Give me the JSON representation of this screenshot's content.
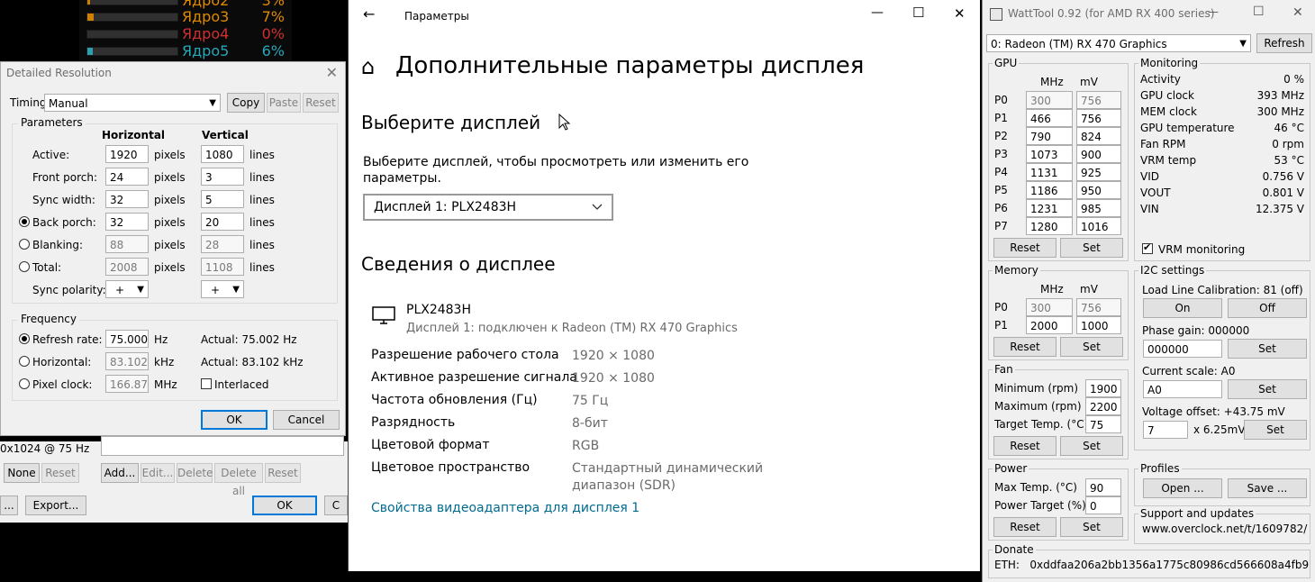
{
  "cpu_cores": [
    {
      "name": "Ядро2",
      "pct": "3%",
      "fill": 0.03,
      "color": "orange"
    },
    {
      "name": "Ядро3",
      "pct": "7%",
      "fill": 0.07,
      "color": "orange"
    },
    {
      "name": "Ядро4",
      "pct": "0%",
      "fill": 0.0,
      "color": "red"
    },
    {
      "name": "Ядро5",
      "pct": "6%",
      "fill": 0.06,
      "color": "teal"
    }
  ],
  "cru_bg": {
    "mode_text": "0x1024 @ 75 Hz",
    "none": "None",
    "reset": "Reset",
    "add": "Add...",
    "edit": "Edit...",
    "delete": "Delete",
    "delete_all": "Delete all",
    "reset2": "Reset",
    "import": "...",
    "export": "Export...",
    "ok": "OK",
    "cancel": "C"
  },
  "detailed": {
    "title": "Detailed Resolution",
    "close": "✕",
    "timing_label": "Timing:",
    "timing_value": "Manual",
    "copy": "Copy",
    "paste": "Paste",
    "reset": "Reset",
    "params_title": "Parameters",
    "col_h": "Horizontal",
    "col_v": "Vertical",
    "rows": [
      {
        "label": "Active:",
        "h": "1920",
        "hu": "pixels",
        "v": "1080",
        "vu": "lines"
      },
      {
        "label": "Front porch:",
        "h": "24",
        "hu": "pixels",
        "v": "3",
        "vu": "lines"
      },
      {
        "label": "Sync width:",
        "h": "32",
        "hu": "pixels",
        "v": "5",
        "vu": "lines"
      },
      {
        "label": "Back porch:",
        "h": "32",
        "hu": "pixels",
        "v": "20",
        "vu": "lines"
      },
      {
        "label": "Blanking:",
        "h": "88",
        "hu": "pixels",
        "v": "28",
        "vu": "lines"
      },
      {
        "label": "Total:",
        "h": "2008",
        "hu": "pixels",
        "v": "1108",
        "vu": "lines"
      }
    ],
    "sync_label": "Sync polarity:",
    "sync_h": "+",
    "sync_v": "+",
    "freq_title": "Frequency",
    "refresh_label": "Refresh rate:",
    "refresh_value": "75.000",
    "refresh_unit": "Hz",
    "refresh_actual": "Actual: 75.002 Hz",
    "horiz_label": "Horizontal:",
    "horiz_value": "83.102",
    "horiz_unit": "kHz",
    "horiz_actual": "Actual: 83.102 kHz",
    "pclk_label": "Pixel clock:",
    "pclk_value": "166.87",
    "pclk_unit": "MHz",
    "interlaced": "Interlaced",
    "ok": "OK",
    "cancel": "Cancel"
  },
  "settings": {
    "back": "←",
    "caption": "Параметры",
    "min": "—",
    "max": "☐",
    "close": "✕",
    "home": "⌂",
    "heading": "Дополнительные параметры дисплея",
    "select_title": "Выберите дисплей",
    "select_desc1": "Выберите дисплей, чтобы просмотреть или изменить его",
    "select_desc2": "параметры.",
    "dropdown": "Дисплей 1: PLX2483H",
    "info_title": "Сведения о дисплее",
    "monitor_name": "PLX2483H",
    "monitor_sub": "Дисплей 1: подключен к Radeon (TM) RX 470 Graphics",
    "rows": [
      {
        "k": "Разрешение рабочего стола",
        "v": "1920 × 1080"
      },
      {
        "k": "Активное разрешение сигнала",
        "v": "1920 × 1080"
      },
      {
        "k": "Частота обновления (Гц)",
        "v": "75 Гц"
      },
      {
        "k": "Разрядность",
        "v": "8-бит"
      },
      {
        "k": "Цветовой формат",
        "v": "RGB"
      },
      {
        "k": "Цветовое пространство",
        "v": "Стандартный динамический",
        "v2": "диапазон (SDR)"
      }
    ],
    "link": "Свойства видеоадаптера для дисплея 1"
  },
  "watttool": {
    "title": "WattTool 0.92 (for AMD RX 400 series)",
    "min": "—",
    "max": "☐",
    "close": "✕",
    "gpu_select": "0: Radeon (TM) RX 470 Graphics",
    "refresh": "Refresh",
    "gpu_title": "GPU",
    "mhz": "MHz",
    "mv": "mV",
    "pstates": [
      {
        "p": "P0",
        "mhz": "300",
        "mv": "756",
        "dis": true
      },
      {
        "p": "P1",
        "mhz": "466",
        "mv": "756"
      },
      {
        "p": "P2",
        "mhz": "790",
        "mv": "824"
      },
      {
        "p": "P3",
        "mhz": "1073",
        "mv": "900"
      },
      {
        "p": "P4",
        "mhz": "1131",
        "mv": "925"
      },
      {
        "p": "P5",
        "mhz": "1186",
        "mv": "950"
      },
      {
        "p": "P6",
        "mhz": "1231",
        "mv": "985"
      },
      {
        "p": "P7",
        "mhz": "1280",
        "mv": "1016"
      }
    ],
    "reset": "Reset",
    "set": "Set",
    "mon_title": "Monitoring",
    "monitoring": [
      {
        "k": "Activity",
        "v": "0 %"
      },
      {
        "k": "GPU clock",
        "v": "393 MHz"
      },
      {
        "k": "MEM clock",
        "v": "300 MHz"
      },
      {
        "k": "GPU temperature",
        "v": "46 °C"
      },
      {
        "k": "Fan RPM",
        "v": "0 rpm"
      },
      {
        "k": "VRM temp",
        "v": "53 °C"
      },
      {
        "k": "VID",
        "v": "0.756 V"
      },
      {
        "k": "VOUT",
        "v": "0.801 V"
      },
      {
        "k": "VIN",
        "v": "12.375 V"
      }
    ],
    "vrm_monitoring": "VRM monitoring",
    "mem_title": "Memory",
    "mem": [
      {
        "p": "P0",
        "mhz": "300",
        "mv": "756",
        "dis": true
      },
      {
        "p": "P1",
        "mhz": "2000",
        "mv": "1000"
      }
    ],
    "i2c_title": "I2C settings",
    "llc_label": "Load Line Calibration: 81 (off)",
    "on": "On",
    "off": "Off",
    "phase_label": "Phase gain: 000000",
    "phase_value": "000000",
    "scale_label": "Current scale: A0",
    "scale_value": "A0",
    "voffset_label": "Voltage offset: +43.75 mV",
    "voffset_value": "7",
    "voffset_mult": "x 6.25mV",
    "fan_title": "Fan",
    "fan_min_label": "Minimum (rpm)",
    "fan_min": "1900",
    "fan_max_label": "Maximum (rpm)",
    "fan_max": "2200",
    "fan_target_label": "Target Temp. (°C)",
    "fan_target": "75",
    "power_title": "Power",
    "max_temp_label": "Max Temp. (°C)",
    "max_temp": "90",
    "ptarget_label": "Power Target (%)",
    "ptarget": "0",
    "profiles_title": "Profiles",
    "open": "Open ...",
    "save": "Save ...",
    "support_title": "Support and updates",
    "support_url": "www.overclock.net/t/1609782/",
    "donate_title": "Donate",
    "eth": "ETH:   0xddfaa206a2bb1356a1775c80986cd566608a4fb9"
  }
}
